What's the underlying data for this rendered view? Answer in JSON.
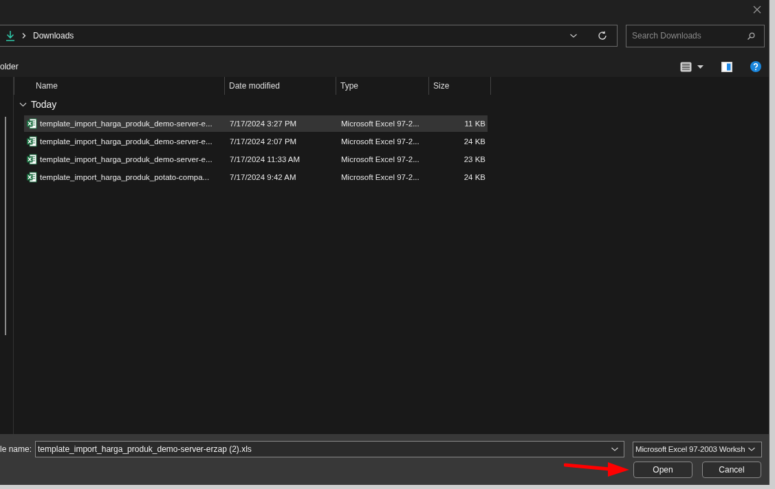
{
  "address_bar": {
    "path": "Downloads"
  },
  "search": {
    "placeholder": "Search Downloads"
  },
  "command_bar": {
    "label": "older"
  },
  "columns": [
    "Name",
    "Date modified",
    "Type",
    "Size"
  ],
  "groups": [
    {
      "label": "Today",
      "expanded": true,
      "files": [
        {
          "name": "template_import_harga_produk_demo-server-e...",
          "date": "7/17/2024 3:27 PM",
          "type": "Microsoft Excel 97-2...",
          "size": "11 KB",
          "selected": true
        },
        {
          "name": "template_import_harga_produk_demo-server-e...",
          "date": "7/17/2024 2:07 PM",
          "type": "Microsoft Excel 97-2...",
          "size": "24 KB",
          "selected": false
        },
        {
          "name": "template_import_harga_produk_demo-server-e...",
          "date": "7/17/2024 11:33 AM",
          "type": "Microsoft Excel 97-2...",
          "size": "23 KB",
          "selected": false
        },
        {
          "name": "template_import_harga_produk_potato-compa...",
          "date": "7/17/2024 9:42 AM",
          "type": "Microsoft Excel 97-2...",
          "size": "24 KB",
          "selected": false
        }
      ]
    }
  ],
  "footer": {
    "file_name_label": "le name:",
    "file_name": "template_import_harga_produk_demo-server-erzap (2).xls",
    "file_type": "Microsoft Excel 97-2003 Worksh",
    "buttons": [
      "Open",
      "Cancel"
    ]
  }
}
